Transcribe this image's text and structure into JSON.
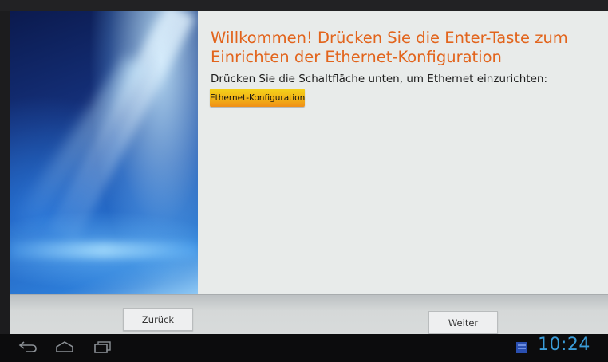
{
  "main": {
    "title": "Willkommen! Drücken Sie die Enter-Taste zum Einrichten der Ethernet-Konfiguration",
    "description": "Drücken Sie die Schaltfläche unten, um Ethernet einzurichten:",
    "ethernet_button_label": "Ethernet-Konfiguration"
  },
  "wizard_nav": {
    "back_label": "Zurück",
    "next_label": "Weiter"
  },
  "system_bar": {
    "icons": [
      "back-icon",
      "home-icon",
      "recent-apps-icon",
      "notification-icon"
    ],
    "time": "10:24"
  },
  "colors": {
    "title": "#e2641c",
    "button_top": "#f4d21a",
    "button_bottom": "#f08f18",
    "clock": "#3a9cd8"
  }
}
